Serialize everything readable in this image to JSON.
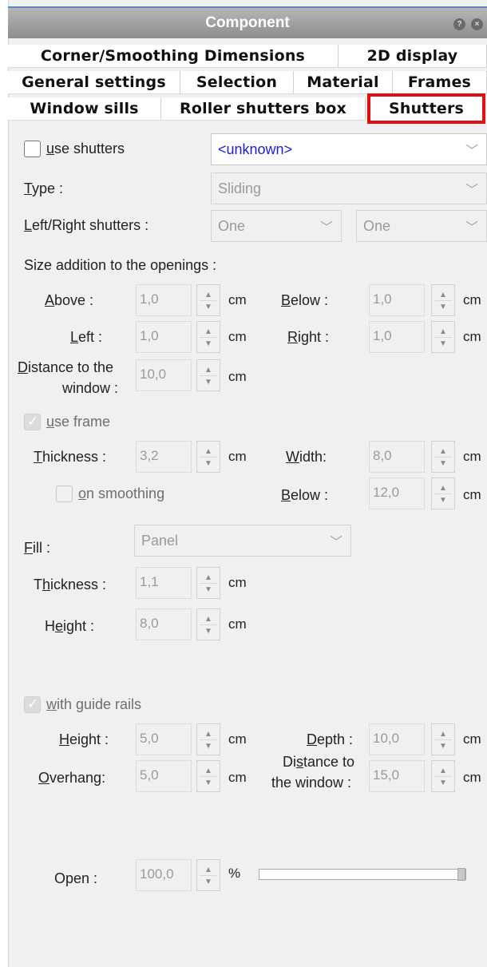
{
  "window": {
    "title": "Component"
  },
  "tabs": {
    "corner": "Corner/Smoothing Dimensions",
    "display2d": "2D display",
    "general": "General settings",
    "selection": "Selection",
    "material": "Material",
    "frames": "Frames",
    "sills": "Window sills",
    "roller": "Roller shutters box",
    "shutters": "Shutters"
  },
  "top": {
    "use_shutters": "se shutters",
    "use_shutters_ul": "u",
    "type_combo": "<unknown>",
    "type_label_ul": "T",
    "type_label": "ype :",
    "type_value": "Sliding",
    "lr_label_ul": "L",
    "lr_label": "eft/Right shutters :",
    "lr_left": "One",
    "lr_right": "One"
  },
  "size": {
    "heading": "Size addition to the openings :",
    "above_ul": "A",
    "above": "bove :",
    "above_val": "1,0",
    "below_ul": "B",
    "below": "elow :",
    "below_val": "1,0",
    "left_ul": "L",
    "left": "eft :",
    "left_val": "1,0",
    "right_ul": "R",
    "right": "ight :",
    "right_val": "1,0",
    "dist_ul": "D",
    "dist_line1": "istance to the",
    "dist_line2": "window :",
    "dist_val": "10,0",
    "unit": "cm"
  },
  "frame": {
    "use_frame_ul": "u",
    "use_frame": "se frame",
    "thick_ul": "T",
    "thick": "hickness :",
    "thick_val": "3,2",
    "width_ul": "W",
    "width": "idth:",
    "width_val": "8,0",
    "smoothing_ul": "o",
    "smoothing": "n smoothing",
    "below_ul": "B",
    "below": "elow :",
    "below_val": "12,0"
  },
  "fill": {
    "label_ul": "F",
    "label": "ill :",
    "value": "Panel",
    "thick_pre": "T",
    "thick_ul": "h",
    "thick": "ickness :",
    "thick_val": "1,1",
    "height_pre": "H",
    "height_ul": "e",
    "height": "ight :",
    "height_val": "8,0"
  },
  "rails": {
    "with_ul": "w",
    "with": "ith guide rails",
    "height_ul": "H",
    "height": "eight :",
    "height_val": "5,0",
    "depth_ul": "D",
    "depth": "epth :",
    "depth_val": "10,0",
    "over_ul": "O",
    "over": "verhang:",
    "over_val": "5,0",
    "dist_pre": "Di",
    "dist_ul": "s",
    "dist": "tance to",
    "dist_line2": "the window :",
    "dist_val": "15,0"
  },
  "open": {
    "label": "Open :",
    "value": "100,0",
    "unit": "%",
    "level": 1.0
  }
}
